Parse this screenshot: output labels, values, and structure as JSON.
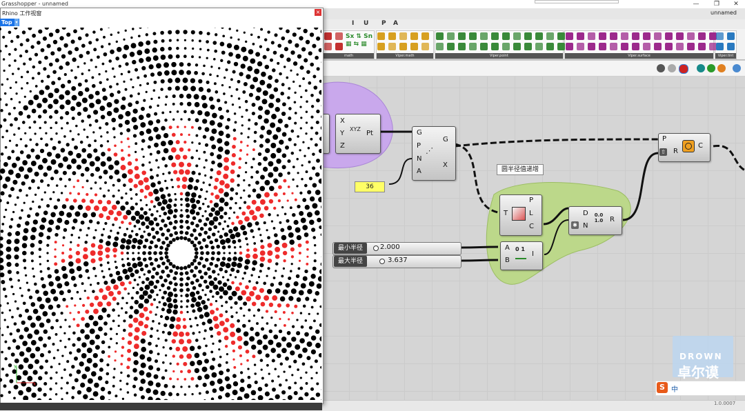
{
  "app": {
    "title": "Grasshopper - unnamed",
    "doc_name": "unnamed"
  },
  "menu": [
    "I",
    "U",
    "P",
    "A"
  ],
  "ribbon": {
    "groups": [
      {
        "label": "math",
        "color": "#c33030"
      },
      {
        "label": "Viper.math",
        "color": "#d7a020"
      },
      {
        "label": "Viper.point",
        "color": "#3a8a3a"
      },
      {
        "label": "Viper.surface",
        "color": "#9c2a8c"
      },
      {
        "label": "Viper.tint",
        "color": "#2a7ac0"
      }
    ]
  },
  "rhino": {
    "title": "Rhino 工作视窗",
    "view": "Top",
    "colors": {
      "black": "#000000",
      "red": "#ee2b2b"
    }
  },
  "canvas": {
    "components": {
      "construct_point": {
        "inputs": [
          "X",
          "Y",
          "Z"
        ],
        "output": "Pt",
        "icon": "XYZ"
      },
      "polygon": {
        "inputs": [
          "G",
          "P",
          "N",
          "A"
        ],
        "outputs": [
          "G",
          "X"
        ]
      },
      "circle": {
        "inputs": [
          "P",
          "R"
        ],
        "output": "C"
      },
      "domain_curve": {
        "input": "T",
        "outputs": [
          "P",
          "L",
          "C"
        ]
      },
      "remap": {
        "inputs": [
          "D",
          "N"
        ],
        "output": "R",
        "icon": "0.0 1.0"
      },
      "bounds": {
        "inputs": [
          "A",
          "B"
        ],
        "output": "I",
        "icon": "0 1"
      }
    },
    "number_panel": "36",
    "tooltip": "圆半径值递增",
    "sliders": [
      {
        "label": "最小半径",
        "value": "2.000"
      },
      {
        "label": "最大半径",
        "value": "3.637"
      }
    ],
    "accent_colors": {
      "purple_group": "#c9a8ec",
      "green_group": "#bcd88a",
      "panel_yellow": "#ffff66"
    }
  },
  "status": {
    "version": "1.0.0007"
  },
  "watermark": {
    "en": "DROWN",
    "cn": "卓尔谟"
  },
  "ime": {
    "label": "中"
  }
}
